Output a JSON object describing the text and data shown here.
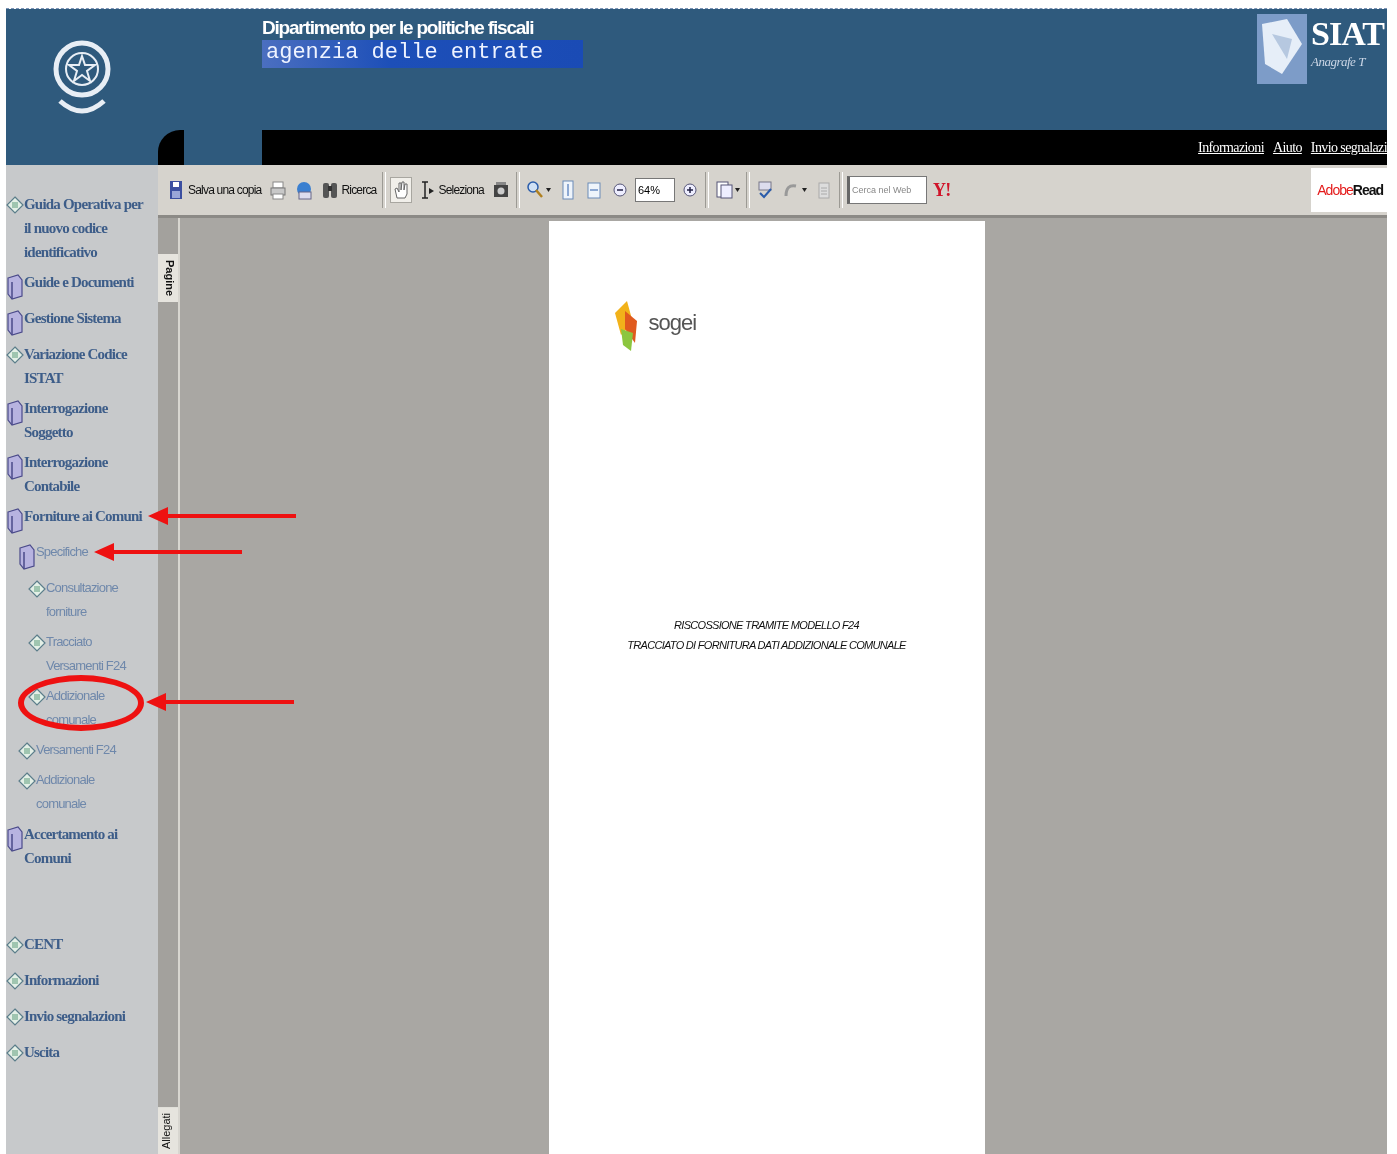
{
  "header": {
    "department": "Dipartimento per le politiche fiscali",
    "agency": "agenzia delle entrate",
    "siat_logo": "SIAT",
    "siat_subtitle": "Anagrafe T",
    "links": [
      "Informazioni",
      "Aiuto",
      "Invio segnalazi"
    ]
  },
  "sidebar": {
    "items": [
      {
        "label": "Guida Operativa per il nuovo codice identificativo",
        "kind": "page",
        "pointed": false,
        "circled": false
      },
      {
        "label": "Guide e Documenti",
        "kind": "folder",
        "pointed": false,
        "circled": false
      },
      {
        "label": "Gestione Sistema",
        "kind": "folder",
        "pointed": false,
        "circled": false
      },
      {
        "label": "Variazione Codice ISTAT",
        "kind": "page",
        "pointed": false,
        "circled": false
      },
      {
        "label": "Interrogazione Soggetto",
        "kind": "folder",
        "pointed": false,
        "circled": false
      },
      {
        "label": "Interrogazione Contabile",
        "kind": "folder",
        "pointed": false,
        "circled": false
      },
      {
        "label": "Forniture ai Comuni",
        "kind": "folder",
        "pointed": true,
        "circled": false,
        "children": [
          {
            "label": "Specifiche",
            "kind": "folder",
            "pointed": true,
            "circled": false,
            "children": [
              {
                "label": "Consultazione forniture",
                "kind": "page",
                "pointed": false,
                "circled": false
              },
              {
                "label": "Tracciato Versamenti F24",
                "kind": "page",
                "pointed": false,
                "circled": false
              },
              {
                "label": "Addizionale comunale",
                "kind": "page",
                "pointed": true,
                "circled": true
              }
            ]
          },
          {
            "label": "Versamenti F24",
            "kind": "page",
            "pointed": false,
            "circled": false
          },
          {
            "label": "Addizionale comunale",
            "kind": "page",
            "pointed": false,
            "circled": false
          }
        ]
      },
      {
        "label": "Accertamento ai Comuni",
        "kind": "folder",
        "pointed": false,
        "circled": false
      }
    ],
    "footer_items": [
      {
        "label": "CENT",
        "kind": "page"
      },
      {
        "label": "Informazioni",
        "kind": "page"
      },
      {
        "label": "Invio segnalazioni",
        "kind": "page"
      },
      {
        "label": "Uscita",
        "kind": "page"
      }
    ]
  },
  "viewer": {
    "toolbar": [
      {
        "kind": "save",
        "label": "Salva una copia"
      },
      {
        "kind": "print"
      },
      {
        "kind": "email"
      },
      {
        "kind": "search",
        "label": "Ricerca"
      },
      {
        "kind": "sep"
      },
      {
        "kind": "hand",
        "selected": true
      },
      {
        "kind": "select",
        "label": "Seleziona",
        "selected": false
      },
      {
        "kind": "camera"
      },
      {
        "kind": "sep"
      },
      {
        "kind": "zoom"
      },
      {
        "kind": "fitpage"
      },
      {
        "kind": "fitwidth"
      },
      {
        "kind": "minus"
      },
      {
        "kind": "zoomfield",
        "value": "64%"
      },
      {
        "kind": "plus"
      },
      {
        "kind": "sep"
      },
      {
        "kind": "pages"
      },
      {
        "kind": "sep"
      },
      {
        "kind": "check"
      },
      {
        "kind": "undo"
      },
      {
        "kind": "clip"
      },
      {
        "kind": "sep"
      },
      {
        "kind": "websearch",
        "placeholder": "Cerca nel Web"
      },
      {
        "kind": "yahoo",
        "label": "Y!"
      }
    ],
    "brand": {
      "adobe": "Adobe",
      "reader": "Read"
    },
    "side_tabs": {
      "top": "Pagine",
      "bottom": "Allegati"
    },
    "document": {
      "logo": "sogei",
      "lines": [
        "RISCOSSIONE TRAMITE MODELLO F24",
        "TRACCIATO DI FORNITURA DATI ADDIZIONALE COMUNALE"
      ]
    }
  }
}
